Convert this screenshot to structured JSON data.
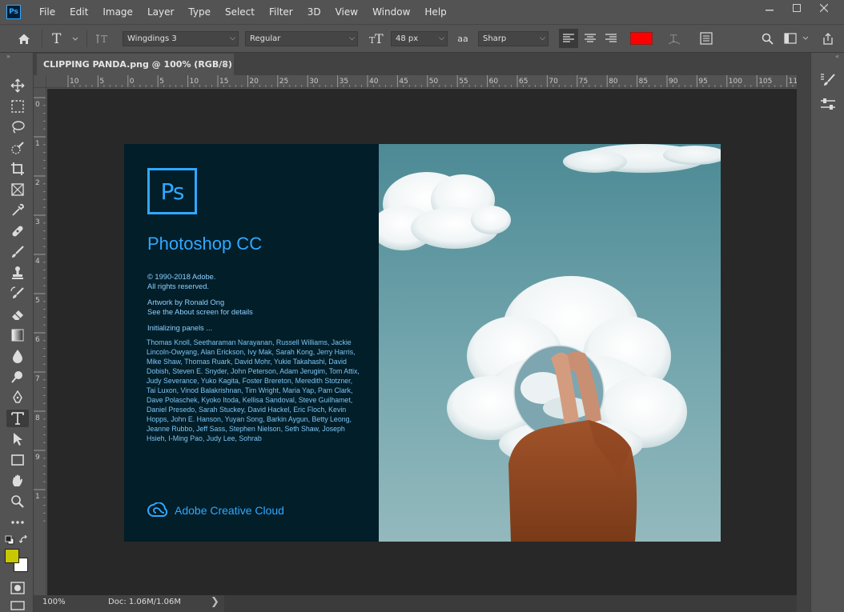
{
  "menubar": {
    "logo": "Ps",
    "items": [
      "File",
      "Edit",
      "Image",
      "Layer",
      "Type",
      "Select",
      "Filter",
      "3D",
      "View",
      "Window",
      "Help"
    ],
    "window_controls": [
      "minimize-icon",
      "restore-icon",
      "close-icon"
    ]
  },
  "options": {
    "font_family": "Wingdings 3",
    "font_style": "Regular",
    "font_size": "48 px",
    "antialias_label": "aa",
    "antialias": "Sharp",
    "text_color": "#ff0000"
  },
  "document": {
    "tab_title": "CLIPPING PANDA.png @ 100% (RGB/8)",
    "close_glyph": "×"
  },
  "rulers": {
    "top": [
      "10",
      "5",
      "0",
      "5",
      "10",
      "15",
      "20",
      "25",
      "30",
      "35",
      "40",
      "45",
      "50",
      "55",
      "60",
      "65",
      "70",
      "75",
      "80",
      "85",
      "90",
      "95",
      "100",
      "105",
      "110"
    ],
    "left": [
      "0",
      "1",
      "2",
      "3",
      "4",
      "5",
      "6",
      "7",
      "8",
      "9",
      "1"
    ]
  },
  "splash": {
    "logo": "Ps",
    "product_name": "Photoshop CC",
    "copyright_line1": "© 1990-2018 Adobe.",
    "copyright_line2": "All rights reserved.",
    "artwork_line1": "Artwork by Ronald Ong",
    "artwork_line2": "See the About screen for details",
    "status": "Initializing panels ...",
    "credits": "Thomas Knoll, Seetharaman Narayanan, Russell Williams, Jackie Lincoln-Owyang, Alan Erickson, Ivy Mak, Sarah Kong, Jerry Harris, Mike Shaw, Thomas Ruark, David Mohr, Yukie Takahashi, David Dobish, Steven E. Snyder, John Peterson, Adam Jerugim, Tom Attix, Judy Severance, Yuko Kagita, Foster Brereton, Meredith Stotzner, Tai Luxon, Vinod Balakrishnan, Tim Wright, Maria Yap, Pam Clark, Dave Polaschek, Kyoko Itoda, Kellisa Sandoval, Steve Guilhamet, Daniel Presedo, Sarah Stuckey, David Hackel, Eric Floch, Kevin Hopps, John E. Hanson, Yuyan Song, Barkin Aygun, Betty Leong, Jeanne Rubbo, Jeff Sass, Stephen Nielson, Seth Shaw, Joseph Hsieh, I-Ming Pao, Judy Lee, Sohrab",
    "cc_label": "Adobe Creative Cloud"
  },
  "status": {
    "zoom": "100%",
    "doc": "Doc: 1.06M/1.06M",
    "chevron": "❯"
  },
  "colors": {
    "accent": "#31a8ff",
    "foreground": "#c8c800",
    "background": "#ffffff",
    "text_color": "#ff0000"
  }
}
